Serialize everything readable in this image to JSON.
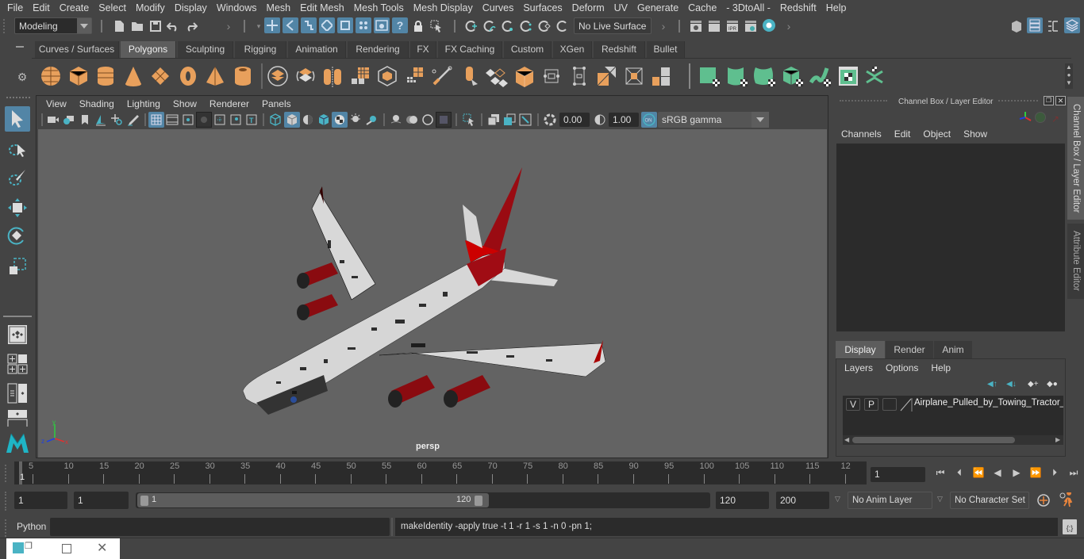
{
  "menubar": {
    "items": [
      "File",
      "Edit",
      "Create",
      "Select",
      "Modify",
      "Display",
      "Windows",
      "Mesh",
      "Edit Mesh",
      "Mesh Tools",
      "Mesh Display",
      "Curves",
      "Surfaces",
      "Deform",
      "UV",
      "Generate",
      "Cache",
      "- 3DtoAll -",
      "Redshift",
      "Help"
    ]
  },
  "status_line": {
    "mode_select": "Modeling",
    "live_surface": "No Live Surface"
  },
  "shelf": {
    "tabs": [
      {
        "label": "Curves / Surfaces",
        "active": false
      },
      {
        "label": "Polygons",
        "active": true
      },
      {
        "label": "Sculpting",
        "active": false
      },
      {
        "label": "Rigging",
        "active": false
      },
      {
        "label": "Animation",
        "active": false
      },
      {
        "label": "Rendering",
        "active": false
      },
      {
        "label": "FX",
        "active": false
      },
      {
        "label": "FX Caching",
        "active": false
      },
      {
        "label": "Custom",
        "active": false
      },
      {
        "label": "XGen",
        "active": false
      },
      {
        "label": "Redshift",
        "active": false
      },
      {
        "label": "Bullet",
        "active": false
      }
    ],
    "poly_icons": [
      "poly-sphere-icon",
      "poly-cube-icon",
      "poly-cylinder-icon",
      "poly-cone-icon",
      "poly-plane-icon",
      "poly-torus-icon",
      "poly-pyramid-icon",
      "poly-pipe-icon",
      "combine-icon",
      "separate-icon",
      "mirror-icon",
      "smooth-icon",
      "extract-icon",
      "poly-grid-icon",
      "multi-cut-icon",
      "extrude-icon",
      "bridge-icon",
      "bevel-icon",
      "fill-hole-icon",
      "append-icon",
      "merge-icon",
      "target-weld-icon",
      "center-pivot-icon"
    ],
    "uv_icons": [
      "planar-uv-icon",
      "cylindrical-uv-icon",
      "spherical-uv-icon",
      "automatic-uv-icon",
      "unfold-uv-icon",
      "uv-editor-icon",
      "layout-uv-icon"
    ]
  },
  "viewport": {
    "menu": [
      "View",
      "Shading",
      "Lighting",
      "Show",
      "Renderer",
      "Panels"
    ],
    "exposure": "0.00",
    "gamma": "1.00",
    "color_mgmt_on": "ON",
    "color_space": "sRGB gamma",
    "camera_label": "persp",
    "axis": {
      "x": "x",
      "y": "y",
      "z": "z"
    }
  },
  "channel_box": {
    "title": "Channel Box / Layer Editor",
    "menu": [
      "Channels",
      "Edit",
      "Object",
      "Show"
    ]
  },
  "layer_editor": {
    "tabs": [
      {
        "label": "Display",
        "active": true
      },
      {
        "label": "Render",
        "active": false
      },
      {
        "label": "Anim",
        "active": false
      }
    ],
    "menu": [
      "Layers",
      "Options",
      "Help"
    ],
    "layers": [
      {
        "v": "V",
        "p": "P",
        "name": "Airplane_Pulled_by_Towing_Tractor_C"
      }
    ]
  },
  "side_tabs": [
    "Channel Box / Layer Editor",
    "Attribute Editor"
  ],
  "timeline": {
    "ticks": [
      "5",
      "10",
      "15",
      "20",
      "25",
      "30",
      "35",
      "40",
      "45",
      "50",
      "55",
      "60",
      "65",
      "70",
      "75",
      "80",
      "85",
      "90",
      "95",
      "100",
      "105",
      "110",
      "115",
      "12"
    ],
    "current_frame_marker": "1",
    "current_frame": "1"
  },
  "range": {
    "start": "1",
    "anim_start": "1",
    "slider_start": "1",
    "slider_end": "120",
    "end": "120",
    "anim_end": "200",
    "anim_layer": "No Anim Layer",
    "character_set": "No Character Set"
  },
  "command_line": {
    "language": "Python",
    "input": "",
    "result": "makeIdentity -apply true -t 1 -r 1 -s 1 -n 0 -pn 1;"
  },
  "colors": {
    "accent_blue": "#5285a6",
    "shelf_orange": "#e8a05c",
    "uv_green": "#5fbf8f",
    "viewport_bg": "#636363",
    "key_orange": "#e8843c"
  }
}
